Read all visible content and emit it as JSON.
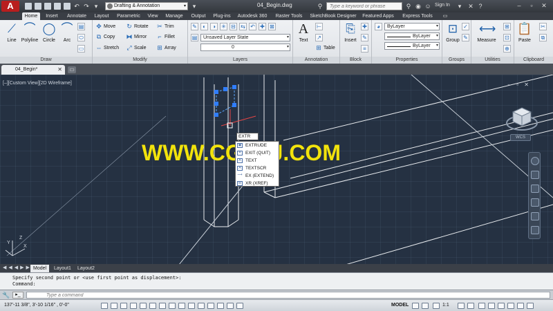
{
  "titlebar": {
    "logo_letter": "A",
    "workspace": "Drafting & Annotation",
    "document_title": "04_Begin.dwg",
    "search_placeholder": "Type a keyword or phrase",
    "signin": "Sign In"
  },
  "ribbon_tabs": [
    "Home",
    "Insert",
    "Annotate",
    "Layout",
    "Parametric",
    "View",
    "Manage",
    "Output",
    "Plug-ins",
    "Autodesk 360",
    "Raster Tools",
    "SketchBook Designer",
    "Featured Apps",
    "Express Tools"
  ],
  "ribbon": {
    "draw": {
      "title": "Draw",
      "line": "Line",
      "polyline": "Polyline",
      "circle": "Circle",
      "arc": "Arc"
    },
    "modify": {
      "title": "Modify",
      "move": "Move",
      "rotate": "Rotate",
      "trim": "Trim",
      "copy": "Copy",
      "mirror": "Mirror",
      "fillet": "Fillet",
      "stretch": "Stretch",
      "scale": "Scale",
      "array": "Array"
    },
    "layers": {
      "title": "Layers",
      "layer_state": "Unsaved Layer State",
      "current_layer": "0"
    },
    "annotation": {
      "title": "Annotation",
      "text": "Text",
      "table": "Table"
    },
    "block": {
      "title": "Block",
      "insert": "Insert"
    },
    "properties": {
      "title": "Properties",
      "color": "ByLayer",
      "linetype": "ByLayer",
      "lineweight": "ByLayer"
    },
    "groups": {
      "title": "Groups",
      "group": "Group"
    },
    "utilities": {
      "title": "Utilities",
      "measure": "Measure"
    },
    "clipboard": {
      "title": "Clipboard",
      "paste": "Paste"
    }
  },
  "file_tab": {
    "label": "04_Begin*"
  },
  "viewport": {
    "label": "[–][Custom View][2D Wireframe]",
    "wcs": "WCS",
    "watermark": "WWW.CGTSJ.COM",
    "ucs_y": "Y",
    "ucs_z": "Z",
    "ucs_x": "X"
  },
  "autocomplete": {
    "typed": "EXTR",
    "items": [
      "EXTRUDE",
      "EXIT (QUIT)",
      "TEXT",
      "TEXTSCR",
      "EX (EXTEND)",
      "XR (XREF)"
    ]
  },
  "layout_tabs": [
    "Model",
    "Layout1",
    "Layout2"
  ],
  "command": {
    "history_1": "Specify second point or <use first point as displacement>:",
    "history_2": "Command:",
    "placeholder": "Type a command"
  },
  "statusbar": {
    "coords": "137'-11 3/8\", 3'-10 1/16\" , 0'-0\"",
    "model": "MODEL",
    "scale": "1:1"
  },
  "colors": {
    "app_red": "#b81e1e",
    "canvas_bg": "#253142",
    "watermark": "#f2e30c",
    "accent_blue": "#1d5fa8"
  }
}
